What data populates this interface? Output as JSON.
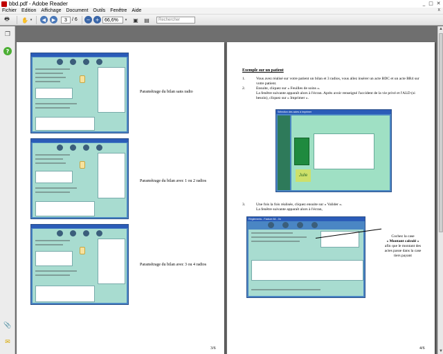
{
  "window": {
    "title": "bbd.pdf - Adobe Reader",
    "minimize": "_",
    "maximize": "□",
    "close": "✕"
  },
  "menu": {
    "items": [
      "Fichier",
      "Edition",
      "Affichage",
      "Document",
      "Outils",
      "Fenêtre",
      "Aide"
    ],
    "close": "x"
  },
  "toolbar": {
    "current_page": "3",
    "total_pages": "/ 6",
    "zoom": "66,6%",
    "search_placeholder": "Rechercher",
    "icons": [
      "print-icon",
      "hand-tool-icon",
      "prev-page-icon",
      "next-page-icon",
      "zoom-out-icon",
      "zoom-in-icon",
      "fit-page-icon",
      "fit-width-icon"
    ]
  },
  "leftnav": {
    "icons": [
      "pages-icon",
      "help-icon",
      "attachment-icon",
      "comments-icon"
    ]
  },
  "left_page": {
    "captions": [
      "Paramétrage du bilan sans radio",
      "Paramétrage du bilan avec 1 ou 2 radios",
      "Paramétrage du bilan avec 3 ou 4 radios"
    ],
    "page_number": "3/6"
  },
  "right_page": {
    "heading": "Exemple sur un patient",
    "step1_num": "1.",
    "step1": "Vous avez réalisé sur votre patient un bilan et 3 radios, vous allez insérer un acte BDC et un acte BR4 sur votre patient.",
    "step2_num": "2.",
    "step2a": "Ensuite, cliquez sur « Feuilles de soins ».",
    "step2b": "La fenêtre suivante apparaît alors à l'écran. Après avoir renseigné l'accident de la vie privé et l'ALD (si besoin), cliquez sur « Imprimer ».",
    "step3_num": "3.",
    "step3a": "Une fois la fois réalisée, cliquez ensuite sur « Valider ».",
    "step3b": "La fenêtre suivante apparaît alors à l'écran,",
    "callout_a": "Cochez la case",
    "callout_b": "« Montant calculé »",
    "callout_c": "afin que le montant des actes passe dans la case tiers payant",
    "shot2_title": "Sélection des actes à imprimer",
    "shot2_logo": "Julie",
    "shot3_title": "Règlements - Facture 84 - 0n",
    "page_number": "4/6"
  }
}
